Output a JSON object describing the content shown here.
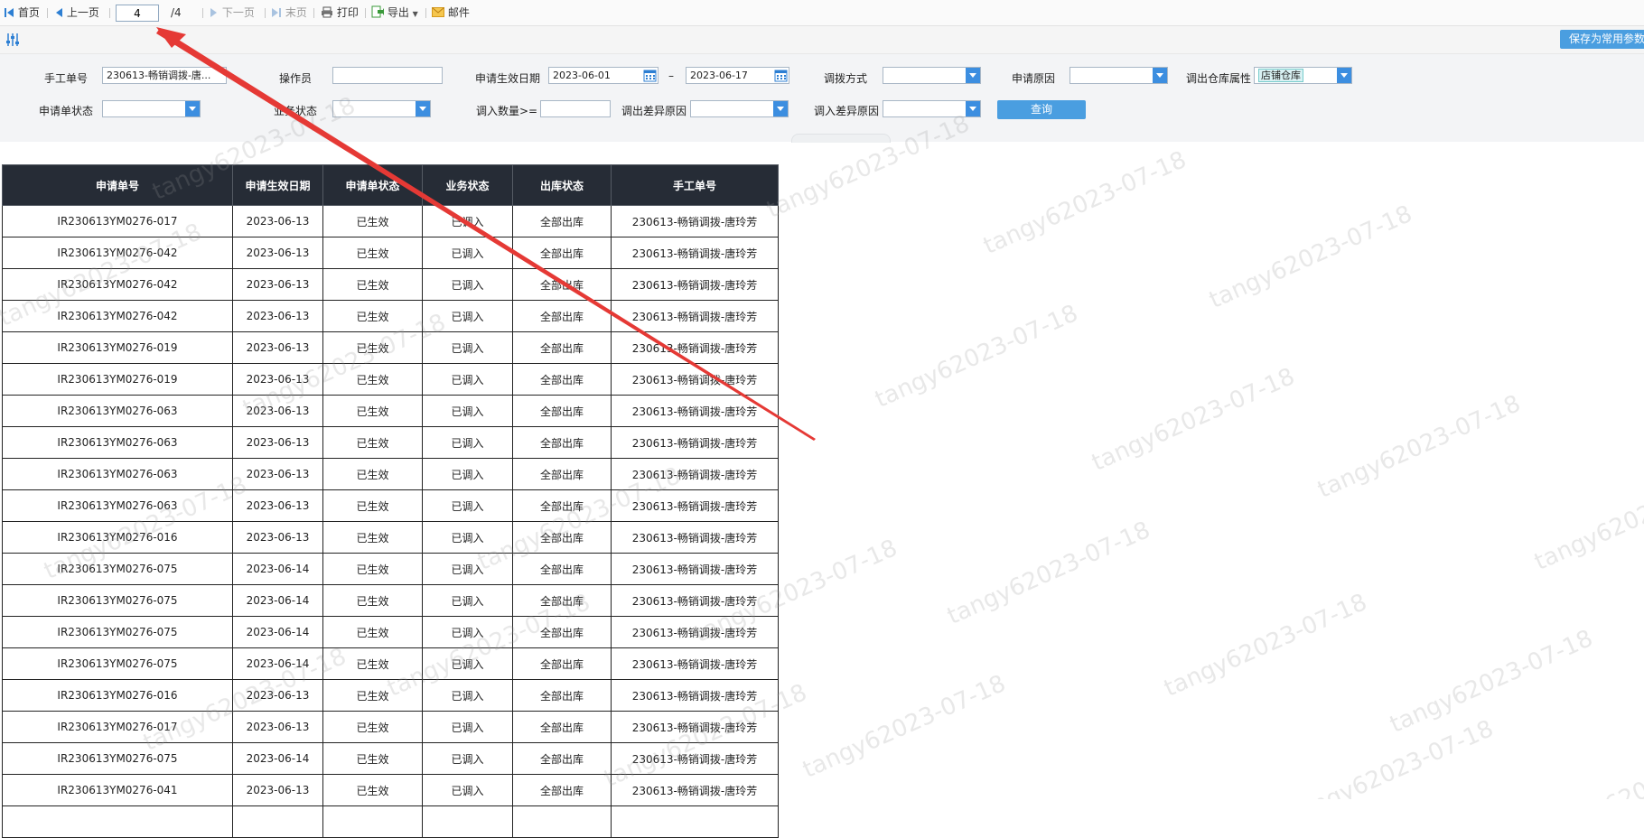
{
  "toolbar": {
    "first_label": "首页",
    "prev_label": "上一页",
    "page_value": "4",
    "total_label": "/4",
    "next_label": "下一页",
    "last_label": "末页",
    "print_label": "打印",
    "export_label": "导出",
    "mail_label": "邮件"
  },
  "save_params_label": "保存为常用参数",
  "filters": {
    "manual_no_label": "手工单号",
    "manual_no_value": "230613-畅销调拨-唐...",
    "operator_label": "操作员",
    "operator_value": "",
    "eff_date_label": "申请生效日期",
    "eff_date_from": "2023-06-01",
    "date_sep": "–",
    "eff_date_to": "2023-06-17",
    "transfer_mode_label": "调拨方式",
    "transfer_mode_value": "",
    "reason_label": "申请原因",
    "reason_value": "",
    "out_wh_attr_label": "调出仓库属性",
    "out_wh_attr_value": "店铺仓库",
    "status_label": "申请单状态",
    "status_value": "",
    "biz_status_label": "业务状态",
    "biz_status_value": "",
    "in_qty_label": "调入数量>=",
    "in_qty_value": "",
    "out_diff_label": "调出差异原因",
    "out_diff_value": "",
    "in_diff_label": "调入差异原因",
    "in_diff_value": "",
    "query_label": "查询"
  },
  "table": {
    "headers": [
      "申请单号",
      "申请生效日期",
      "申请单状态",
      "业务状态",
      "出库状态",
      "手工单号"
    ],
    "rows": [
      [
        "IR230613YM0276-017",
        "2023-06-13",
        "已生效",
        "已调入",
        "全部出库",
        "230613-畅销调拨-唐玲芳"
      ],
      [
        "IR230613YM0276-042",
        "2023-06-13",
        "已生效",
        "已调入",
        "全部出库",
        "230613-畅销调拨-唐玲芳"
      ],
      [
        "IR230613YM0276-042",
        "2023-06-13",
        "已生效",
        "已调入",
        "全部出库",
        "230613-畅销调拨-唐玲芳"
      ],
      [
        "IR230613YM0276-042",
        "2023-06-13",
        "已生效",
        "已调入",
        "全部出库",
        "230613-畅销调拨-唐玲芳"
      ],
      [
        "IR230613YM0276-019",
        "2023-06-13",
        "已生效",
        "已调入",
        "全部出库",
        "230613-畅销调拨-唐玲芳"
      ],
      [
        "IR230613YM0276-019",
        "2023-06-13",
        "已生效",
        "已调入",
        "全部出库",
        "230613-畅销调拨-唐玲芳"
      ],
      [
        "IR230613YM0276-063",
        "2023-06-13",
        "已生效",
        "已调入",
        "全部出库",
        "230613-畅销调拨-唐玲芳"
      ],
      [
        "IR230613YM0276-063",
        "2023-06-13",
        "已生效",
        "已调入",
        "全部出库",
        "230613-畅销调拨-唐玲芳"
      ],
      [
        "IR230613YM0276-063",
        "2023-06-13",
        "已生效",
        "已调入",
        "全部出库",
        "230613-畅销调拨-唐玲芳"
      ],
      [
        "IR230613YM0276-063",
        "2023-06-13",
        "已生效",
        "已调入",
        "全部出库",
        "230613-畅销调拨-唐玲芳"
      ],
      [
        "IR230613YM0276-016",
        "2023-06-13",
        "已生效",
        "已调入",
        "全部出库",
        "230613-畅销调拨-唐玲芳"
      ],
      [
        "IR230613YM0276-075",
        "2023-06-14",
        "已生效",
        "已调入",
        "全部出库",
        "230613-畅销调拨-唐玲芳"
      ],
      [
        "IR230613YM0276-075",
        "2023-06-14",
        "已生效",
        "已调入",
        "全部出库",
        "230613-畅销调拨-唐玲芳"
      ],
      [
        "IR230613YM0276-075",
        "2023-06-14",
        "已生效",
        "已调入",
        "全部出库",
        "230613-畅销调拨-唐玲芳"
      ],
      [
        "IR230613YM0276-075",
        "2023-06-14",
        "已生效",
        "已调入",
        "全部出库",
        "230613-畅销调拨-唐玲芳"
      ],
      [
        "IR230613YM0276-016",
        "2023-06-13",
        "已生效",
        "已调入",
        "全部出库",
        "230613-畅销调拨-唐玲芳"
      ],
      [
        "IR230613YM0276-017",
        "2023-06-13",
        "已生效",
        "已调入",
        "全部出库",
        "230613-畅销调拨-唐玲芳"
      ],
      [
        "IR230613YM0276-075",
        "2023-06-14",
        "已生效",
        "已调入",
        "全部出库",
        "230613-畅销调拨-唐玲芳"
      ],
      [
        "IR230613YM0276-041",
        "2023-06-13",
        "已生效",
        "已调入",
        "全部出库",
        "230613-畅销调拨-唐玲芳"
      ],
      [
        "",
        "",
        "",
        "",
        "",
        ""
      ]
    ]
  },
  "watermark_text": "tangy62023-07-18",
  "colors": {
    "accent": "#4a9ee0",
    "header_bg": "#262c36",
    "arrow": "#e53935"
  }
}
